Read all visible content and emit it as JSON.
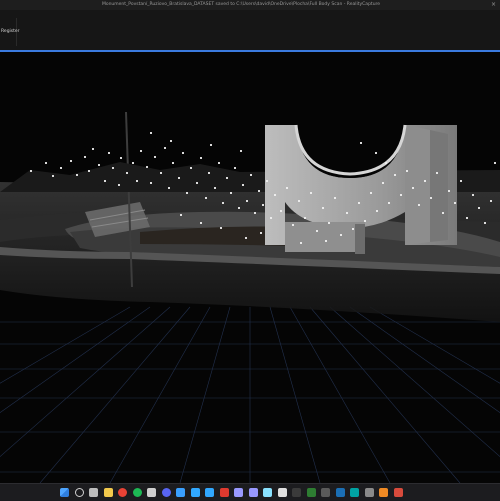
{
  "window": {
    "title": "Monument_Povstaní_Ruziovo_Bratislava_DATASET saved to C:\\Users\\david\\OneDrive\\Plocha\\Full Body Scan - RealityCapture",
    "close_glyph": "×"
  },
  "ribbon": {
    "button_label": "Register"
  },
  "viewport": {
    "accent_color": "#3b7be0",
    "grid_color": "#22304d",
    "description_icon": "3d-point-cloud"
  },
  "taskbar": {
    "icons": [
      {
        "name": "windows-start-icon",
        "color": "#4ea5ff"
      },
      {
        "name": "search-icon",
        "color": "#d0d0d0"
      },
      {
        "name": "task-view-icon",
        "color": "#bdbdbd"
      },
      {
        "name": "file-explorer-icon",
        "color": "#f2c94c"
      },
      {
        "name": "chrome-icon",
        "color": "#e94235"
      },
      {
        "name": "spotify-icon",
        "color": "#1db954"
      },
      {
        "name": "obs-icon",
        "color": "#cfcfcf"
      },
      {
        "name": "discord-icon",
        "color": "#5865f2"
      },
      {
        "name": "app-icon-blue",
        "color": "#3aa0ff"
      },
      {
        "name": "photoshop-icon",
        "color": "#31a8ff"
      },
      {
        "name": "lightroom-icon",
        "color": "#31a8ff"
      },
      {
        "name": "acrobat-icon",
        "color": "#e03a2f"
      },
      {
        "name": "premiere-icon",
        "color": "#9999ff"
      },
      {
        "name": "after-effects-icon",
        "color": "#9999ff"
      },
      {
        "name": "media-encoder-icon",
        "color": "#8ae2ff"
      },
      {
        "name": "unity-icon",
        "color": "#e0e0e0"
      },
      {
        "name": "app-icon-dark",
        "color": "#3a3a3a"
      },
      {
        "name": "app-icon-green",
        "color": "#2e7d32"
      },
      {
        "name": "terminal-icon",
        "color": "#5a5a5a"
      },
      {
        "name": "steam-icon",
        "color": "#1b6fb5"
      },
      {
        "name": "app-icon-teal",
        "color": "#00a3a3"
      },
      {
        "name": "app-icon-grey",
        "color": "#8a8a8a"
      },
      {
        "name": "app-icon-orange",
        "color": "#f08a24"
      },
      {
        "name": "realitycapture-icon",
        "color": "#d84b3c"
      }
    ]
  }
}
